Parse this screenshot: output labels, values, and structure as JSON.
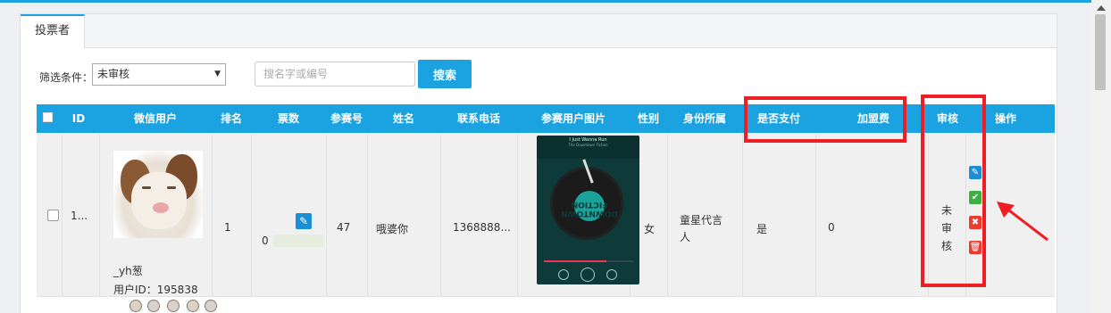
{
  "tab": {
    "label": "投票者"
  },
  "filter": {
    "label": "筛选条件：",
    "selected": "未审核"
  },
  "search": {
    "placeholder": "搜名字或编号",
    "button": "搜索"
  },
  "columns": [
    "ID",
    "微信用户",
    "排名",
    "票数",
    "参赛号",
    "姓名",
    "联系电话",
    "参赛用户图片",
    "性别",
    "身份所属",
    "是否支付",
    "加盟费",
    "审核",
    "操作"
  ],
  "row": {
    "id": "1...",
    "nickname": "_yh葱",
    "user_id": "用户ID：195838",
    "rank": "1",
    "votes": "0",
    "entry_no": "47",
    "name": "哦婆你",
    "phone": "1368888...",
    "gender": "女",
    "identity_line1": "童星代言",
    "identity_line2": "人",
    "paid": "是",
    "fee": "0",
    "review": [
      "未",
      "审",
      "核"
    ]
  },
  "phone_screen": {
    "song": "I Just Wanna Run",
    "artist": "The Downtown Fiction",
    "disc_text": "DOWNTOWN FICTION"
  },
  "annotation_color": "#ef1d24",
  "accent_color": "#1aa3e0"
}
